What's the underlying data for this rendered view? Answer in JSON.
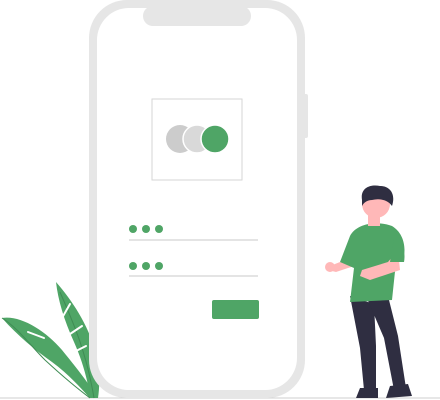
{
  "scene": {
    "description_hidden": "",
    "colors": {
      "accent": "#4fa566",
      "leaf": "#4fa566",
      "frame": "#e6e6e6",
      "screen": "#ffffff",
      "circle_light": "#cccccc",
      "circle_mid": "#d9d9d9",
      "line": "#dcdcdc",
      "skin": "#ffb8b8",
      "hair": "#2f2e41",
      "shirt": "#4fa566",
      "pants": "#2f2e41",
      "ground": "#cfcfcf"
    }
  },
  "phone": {
    "logo_card": {
      "icon": "overlapping-circles-logo-icon"
    },
    "password_field_1": {
      "masked_value": "•••"
    },
    "password_field_2": {
      "masked_value": "•••"
    },
    "submit_button": {
      "label": ""
    }
  },
  "illustration": {
    "icons": [
      "leaf-icon",
      "person-icon"
    ]
  }
}
